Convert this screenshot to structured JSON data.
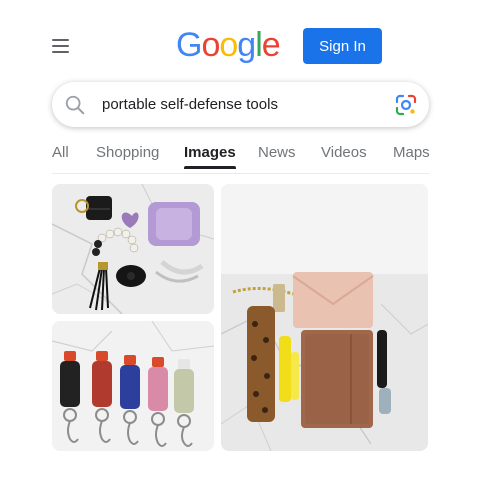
{
  "header": {
    "logo_letters": [
      "G",
      "o",
      "o",
      "g",
      "l",
      "e"
    ],
    "logo_colors": [
      "#4285f4",
      "#ea4335",
      "#fbbc05",
      "#4285f4",
      "#34a853",
      "#ea4335"
    ],
    "signin_label": "Sign In",
    "accent_color": "#1a73e8"
  },
  "search": {
    "query": "portable self-defense tools"
  },
  "tabs": [
    {
      "label": "All",
      "active": false
    },
    {
      "label": "Shopping",
      "active": false
    },
    {
      "label": "Images",
      "active": true
    },
    {
      "label": "News",
      "active": false
    },
    {
      "label": "Videos",
      "active": false
    },
    {
      "label": "Maps",
      "active": false
    }
  ],
  "results": [
    {
      "subject": "keychain set with pouch, bracelet, tassel and alarm"
    },
    {
      "subject": "row of five pepper spray keychains"
    },
    {
      "subject": "wallet, leopard comb, notebook and pen keychains"
    }
  ]
}
